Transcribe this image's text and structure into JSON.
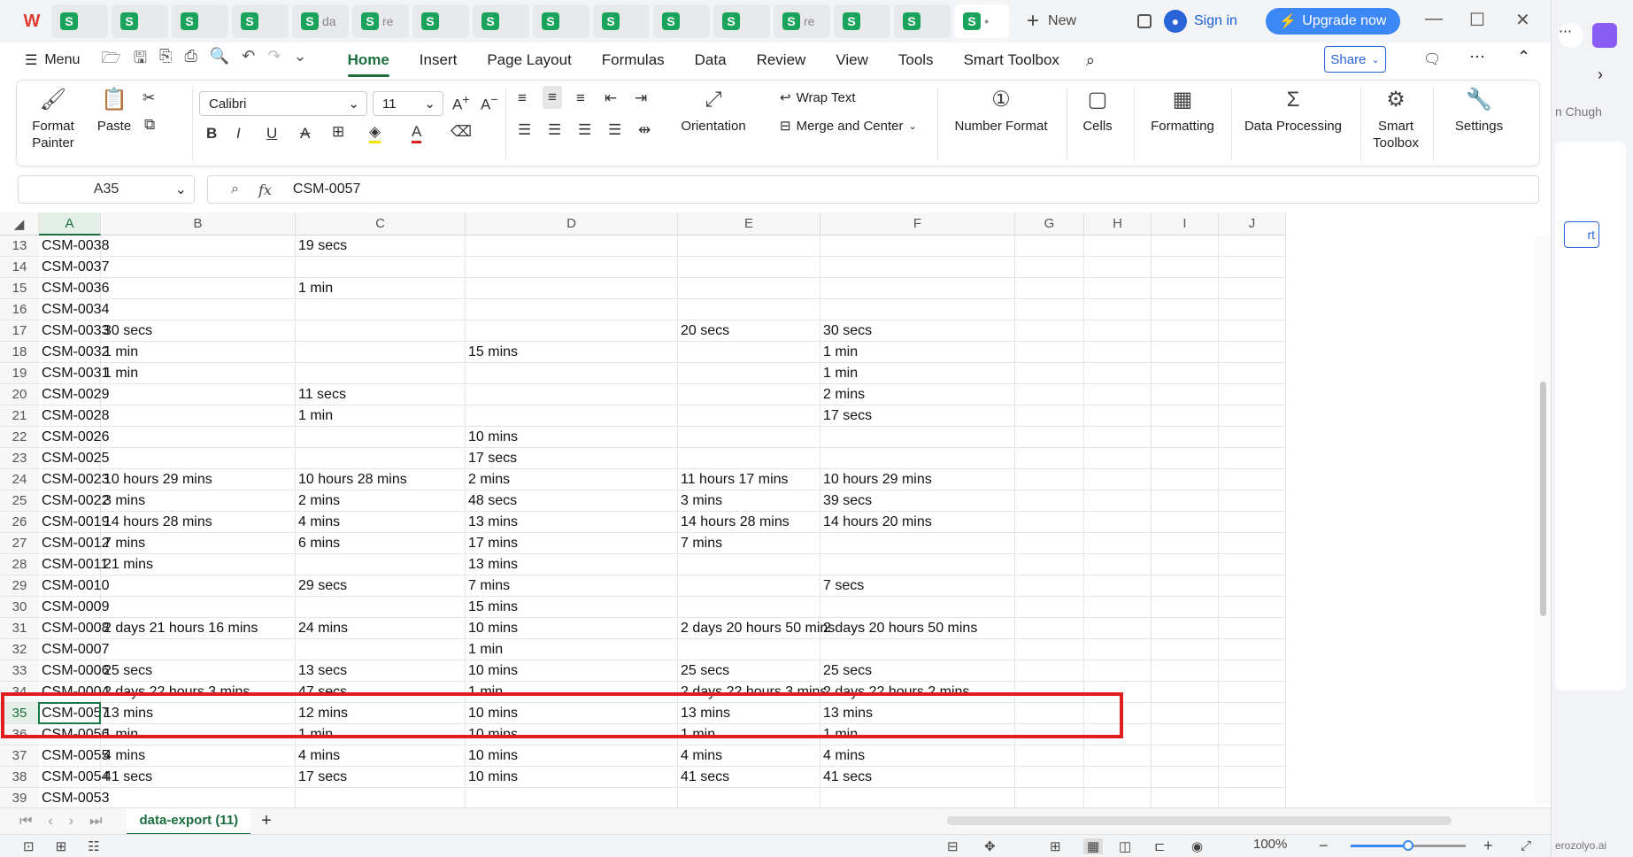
{
  "titlebar": {
    "tabs": [
      "",
      "",
      "",
      "",
      "da",
      "re",
      "",
      "",
      "",
      "",
      "",
      "",
      "re",
      "",
      "",
      ""
    ],
    "new_label": "New",
    "signin_label": "Sign in",
    "upgrade_label": "Upgrade now"
  },
  "menubar": {
    "menu_label": "Menu",
    "tabs": [
      "Home",
      "Insert",
      "Page Layout",
      "Formulas",
      "Data",
      "Review",
      "View",
      "Tools",
      "Smart Toolbox"
    ],
    "share_label": "Share"
  },
  "ribbon": {
    "format_painter": "Format Painter",
    "paste": "Paste",
    "font_name": "Calibri",
    "font_size": "11",
    "wrap_text": "Wrap Text",
    "merge_center": "Merge and Center",
    "orientation": "Orientation",
    "number_format": "Number Format",
    "cells": "Cells",
    "formatting": "Formatting",
    "data_processing": "Data Processing",
    "smart_toolbox": "Smart Toolbox",
    "settings": "Settings"
  },
  "formula_bar": {
    "name_box": "A35",
    "fx_label": "fx",
    "value": "CSM-0057"
  },
  "columns": [
    "A",
    "B",
    "C",
    "D",
    "E",
    "F",
    "G",
    "H",
    "I",
    "J"
  ],
  "rows": [
    {
      "n": "13",
      "cells": [
        "CSM-0038",
        "",
        "19 secs",
        "",
        "",
        ""
      ]
    },
    {
      "n": "14",
      "cells": [
        "CSM-0037",
        "",
        "",
        "",
        "",
        ""
      ]
    },
    {
      "n": "15",
      "cells": [
        "CSM-0036",
        "",
        "1 min",
        "",
        "",
        ""
      ]
    },
    {
      "n": "16",
      "cells": [
        "CSM-0034",
        "",
        "",
        "",
        "",
        ""
      ]
    },
    {
      "n": "17",
      "cells": [
        "CSM-0033",
        "30 secs",
        "",
        "",
        "20 secs",
        "30 secs"
      ]
    },
    {
      "n": "18",
      "cells": [
        "CSM-0032",
        "1 min",
        "",
        "15 mins",
        "",
        "1 min"
      ]
    },
    {
      "n": "19",
      "cells": [
        "CSM-0031",
        "1 min",
        "",
        "",
        "",
        "1 min"
      ]
    },
    {
      "n": "20",
      "cells": [
        "CSM-0029",
        "",
        "11 secs",
        "",
        "",
        "2 mins"
      ]
    },
    {
      "n": "21",
      "cells": [
        "CSM-0028",
        "",
        "1 min",
        "",
        "",
        "17 secs"
      ]
    },
    {
      "n": "22",
      "cells": [
        "CSM-0026",
        "",
        "",
        "10 mins",
        "",
        ""
      ]
    },
    {
      "n": "23",
      "cells": [
        "CSM-0025",
        "",
        "",
        "17 secs",
        "",
        ""
      ]
    },
    {
      "n": "24",
      "cells": [
        "CSM-0023",
        "10 hours 29 mins",
        "10 hours 28 mins",
        "2 mins",
        "11 hours 17 mins",
        "10 hours 29 mins"
      ]
    },
    {
      "n": "25",
      "cells": [
        "CSM-0022",
        "3 mins",
        "2 mins",
        "48 secs",
        "3 mins",
        "39 secs"
      ]
    },
    {
      "n": "26",
      "cells": [
        "CSM-0019",
        "14 hours 28 mins",
        "4 mins",
        "13 mins",
        "14 hours 28 mins",
        "14 hours 20 mins"
      ]
    },
    {
      "n": "27",
      "cells": [
        "CSM-0012",
        "7 mins",
        "6 mins",
        "17 mins",
        "7 mins",
        ""
      ]
    },
    {
      "n": "28",
      "cells": [
        "CSM-0011",
        "21 mins",
        "",
        "13 mins",
        "",
        ""
      ]
    },
    {
      "n": "29",
      "cells": [
        "CSM-0010",
        "",
        "29 secs",
        "7 mins",
        "",
        "7 secs"
      ]
    },
    {
      "n": "30",
      "cells": [
        "CSM-0009",
        "",
        "",
        "15 mins",
        "",
        ""
      ]
    },
    {
      "n": "31",
      "cells": [
        "CSM-0008",
        "2 days 21 hours 16 mins",
        "24 mins",
        "10 mins",
        "2 days 20 hours 50 mins",
        "2 days 20 hours 50 mins"
      ]
    },
    {
      "n": "32",
      "cells": [
        "CSM-0007",
        "",
        "",
        "1 min",
        "",
        ""
      ]
    },
    {
      "n": "33",
      "cells": [
        "CSM-0006",
        "25 secs",
        "13 secs",
        "10 mins",
        "25 secs",
        "25 secs"
      ]
    },
    {
      "n": "34",
      "cells": [
        "CSM-0004",
        "2 days 22 hours 3 mins",
        "47 secs",
        "1 min",
        "2 days 22 hours 3 mins",
        "2 days 22 hours 2 mins"
      ]
    },
    {
      "n": "35",
      "cells": [
        "CSM-0057",
        "13 mins",
        "12 mins",
        "10 mins",
        "13 mins",
        "13 mins"
      ]
    },
    {
      "n": "36",
      "cells": [
        "CSM-0056",
        "1 min",
        "1 min",
        "10 mins",
        "1 min",
        "1 min"
      ]
    },
    {
      "n": "37",
      "cells": [
        "CSM-0055",
        "4 mins",
        "4 mins",
        "10 mins",
        "4 mins",
        "4 mins"
      ]
    },
    {
      "n": "38",
      "cells": [
        "CSM-0054",
        "41 secs",
        "17 secs",
        "10 mins",
        "41 secs",
        "41 secs"
      ]
    },
    {
      "n": "39",
      "cells": [
        "CSM-0053",
        "",
        "",
        "",
        "",
        ""
      ]
    }
  ],
  "sheet_tab": "data-export (11)",
  "status": {
    "zoom": "100%",
    "zoom_level_percent": 100
  },
  "side_panel": {
    "user_fragment": "n Chugh",
    "button_fragment": "rt",
    "footer_fragment": "erozolyo.ai"
  },
  "colors": {
    "accent_green": "#1a6f3d",
    "highlight_red": "#e01e1e",
    "upgrade_blue": "#3d88f7"
  }
}
